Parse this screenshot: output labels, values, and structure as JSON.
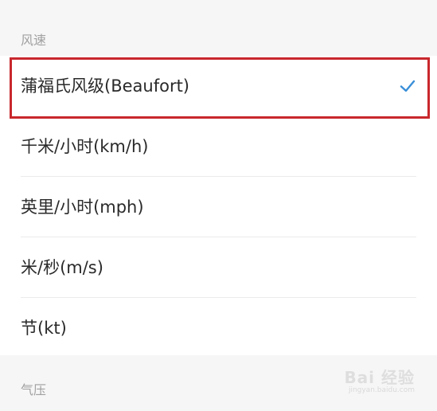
{
  "wind_section": {
    "title": "风速"
  },
  "options": [
    {
      "label": "蒲福氏风级(Beaufort)",
      "selected": true
    },
    {
      "label": "千米/小时(km/h)",
      "selected": false
    },
    {
      "label": "英里/小时(mph)",
      "selected": false
    },
    {
      "label": "米/秒(m/s)",
      "selected": false
    },
    {
      "label": "节(kt)",
      "selected": false
    }
  ],
  "pressure_section": {
    "title": "气压"
  },
  "watermark": {
    "main": "Bai 经验",
    "sub": "jingyan.baidu.com"
  },
  "colors": {
    "accent": "#3a8fd8",
    "highlight_border": "#c8282d"
  },
  "icons": {
    "selected_indicator": "checkmark-icon"
  }
}
